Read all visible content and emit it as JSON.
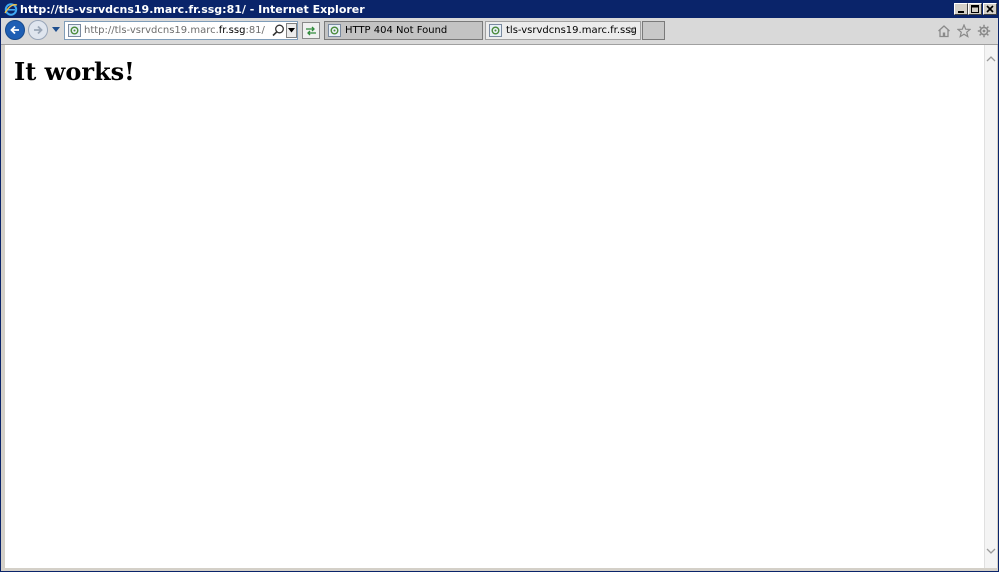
{
  "window": {
    "title": "http://tls-vsrvdcns19.marc.fr.ssg:81/ - Internet Explorer"
  },
  "toolbar": {
    "address": {
      "prefix": "http://tls-vsrvdcns19.marc.",
      "domain": "fr.ssg",
      "suffix": ":81/"
    },
    "tabs": [
      {
        "label": "HTTP 404 Not Found",
        "active": false
      },
      {
        "label": "tls-vsrvdcns19.marc.fr.ssg",
        "active": true,
        "close": "×"
      }
    ]
  },
  "page": {
    "heading": "It works!"
  },
  "colors": {
    "titlebar": "#0a246a",
    "back_button": "#1f5fb4"
  },
  "icons": [
    "ie-logo-icon",
    "minimize-icon",
    "maximize-icon",
    "close-icon",
    "back-arrow-icon",
    "forward-arrow-icon",
    "chevron-down-icon",
    "page-icon",
    "search-icon",
    "compatibility-view-icon",
    "home-icon",
    "star-icon",
    "gear-icon",
    "scroll-up-icon",
    "scroll-down-icon"
  ]
}
